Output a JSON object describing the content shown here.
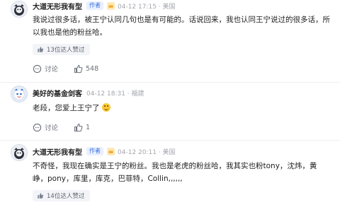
{
  "posts": [
    {
      "name": "大道无形我有型",
      "author_tag": "作者",
      "meta": "04-12 17:15 · 美国",
      "text": "我说过很多话，被王宁认同几句也是有可能的。话说回来，我也认同王宁说过的很多话，所以我也是他的粉丝哈。",
      "likes_summary": "13位达人赞过",
      "comment_label": "讨论",
      "like_count": "548"
    },
    {
      "name": "美好的基金剑客",
      "meta": "04-12 18:31 · 福建",
      "text": "老段，您爱上王宁了",
      "comment_label": "讨论",
      "like_count": "1"
    },
    {
      "name": "大道无形我有型",
      "author_tag": "作者",
      "meta": "04-12 20:11 · 美国",
      "text": "不奇怪，我现在确实是王宁的粉丝。我也是老虎的粉丝哈，我其实也粉tony，沈炜，黄峥，pony，库里，库克，巴菲特，Collin,,,,,,",
      "likes_summary": "14位达人赞过"
    }
  ],
  "icons": {
    "crown": "crown-icon",
    "avatar": "avatar-icon",
    "thumb": "thumbs-up-icon",
    "comment": "comment-icon",
    "emoji": "laughing-emoji-icon"
  },
  "colors": {
    "accent": "#3a6fd8",
    "crown": "#f5a623",
    "muted": "#a3a6ad"
  }
}
